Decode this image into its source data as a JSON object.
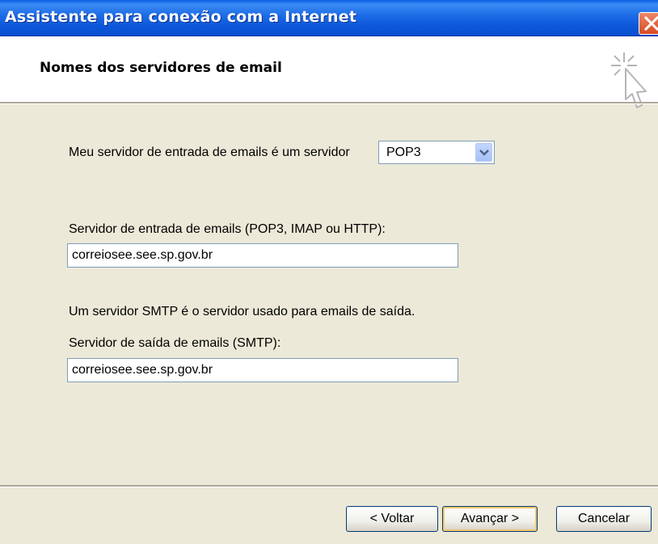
{
  "window": {
    "title": "Assistente para conexão com a Internet"
  },
  "header": {
    "title": "Nomes dos servidores de email"
  },
  "form": {
    "incoming_type_label": "Meu servidor de entrada de emails é um  servidor",
    "incoming_type_value": "POP3",
    "incoming_server_label": "Servidor de entrada de emails (POP3, IMAP ou HTTP):",
    "incoming_server_value": "correiosee.see.sp.gov.br",
    "smtp_info": "Um servidor SMTP é o servidor usado para emails de saída.",
    "outgoing_server_label": "Servidor de saída de emails (SMTP):",
    "outgoing_server_value": "correiosee.see.sp.gov.br"
  },
  "buttons": {
    "back": "< Voltar",
    "next": "Avançar >",
    "cancel": "Cancelar"
  },
  "icons": {
    "close": "close-icon",
    "wizard": "cursor-sparkle-icon",
    "dropdown": "chevron-down-icon"
  }
}
